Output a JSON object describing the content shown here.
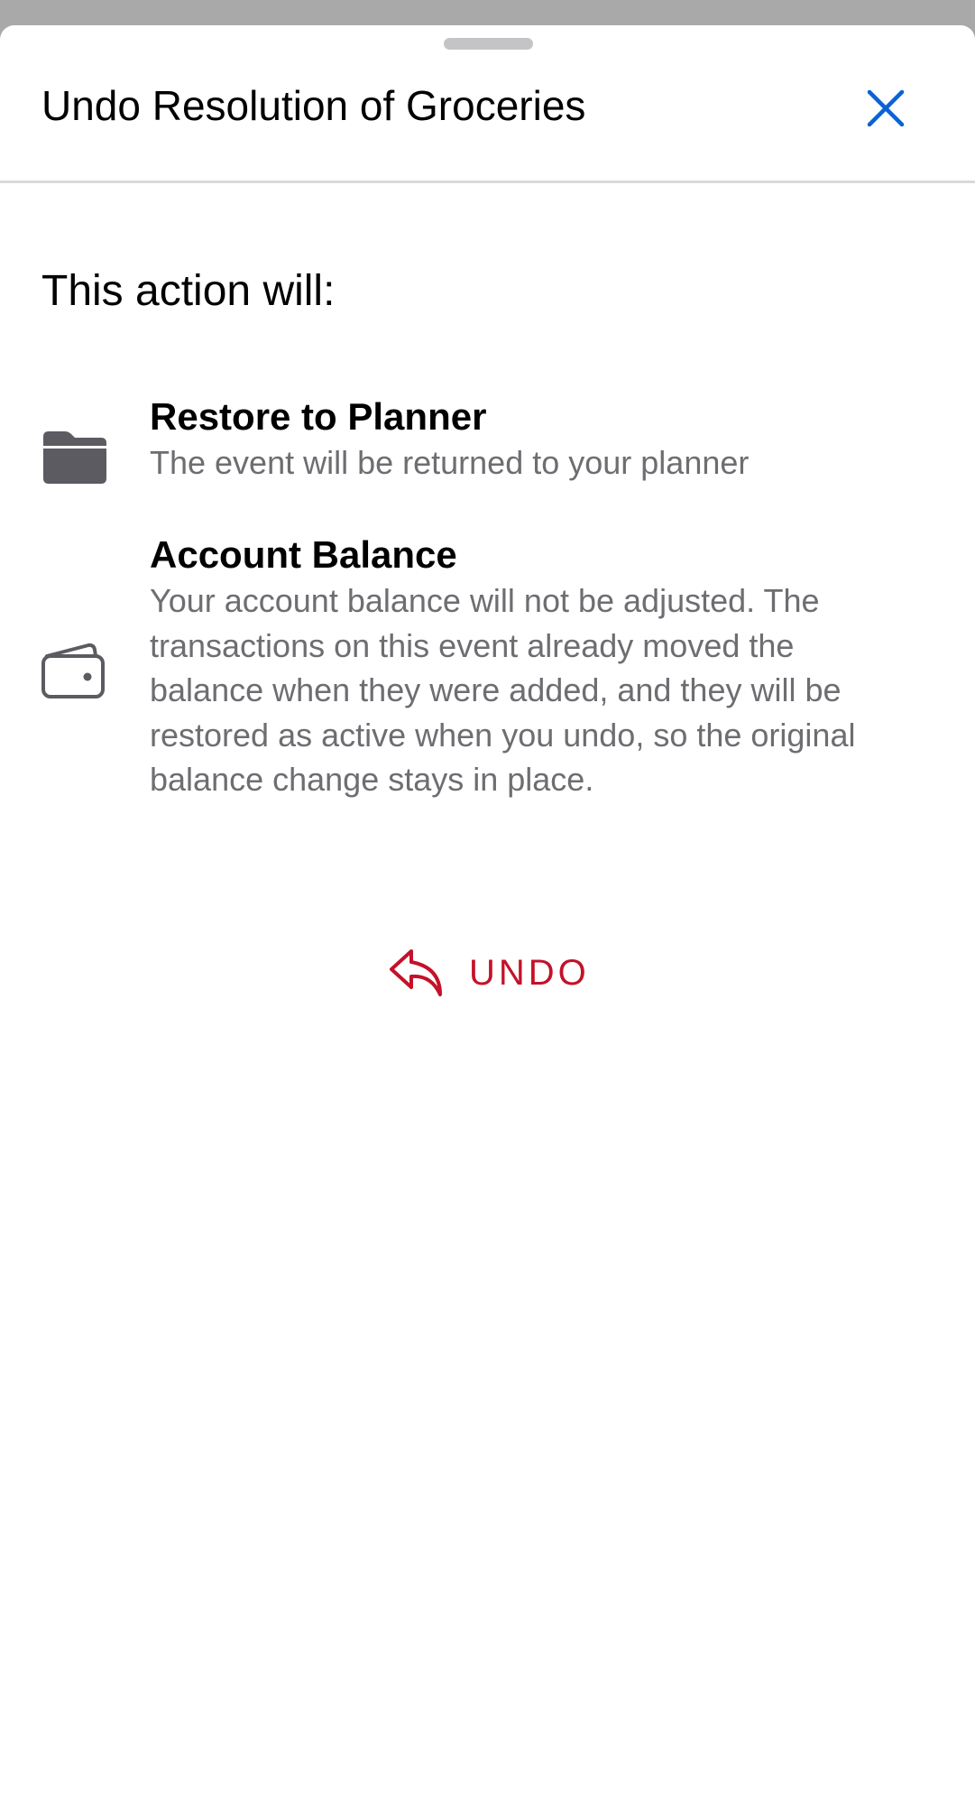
{
  "sheet": {
    "title": "Undo Resolution of Groceries",
    "close_icon": "close-icon"
  },
  "content": {
    "intro": "This action will:",
    "items": [
      {
        "icon": "folder-icon",
        "title": "Restore to Planner",
        "description": "The event will be returned to your planner"
      },
      {
        "icon": "wallet-icon",
        "title": "Account Balance",
        "description": "Your account balance will not be adjusted. The transactions on this event already moved the balance when they were added, and they will be restored as active when you undo, so the original balance change stays in place."
      }
    ]
  },
  "action": {
    "icon": "reply-arrow-icon",
    "label": "UNDO"
  },
  "colors": {
    "accent_blue": "#0a62d6",
    "destructive_red": "#c3122a",
    "icon_gray": "#5b5b61",
    "secondary_text": "#6d6d72"
  }
}
